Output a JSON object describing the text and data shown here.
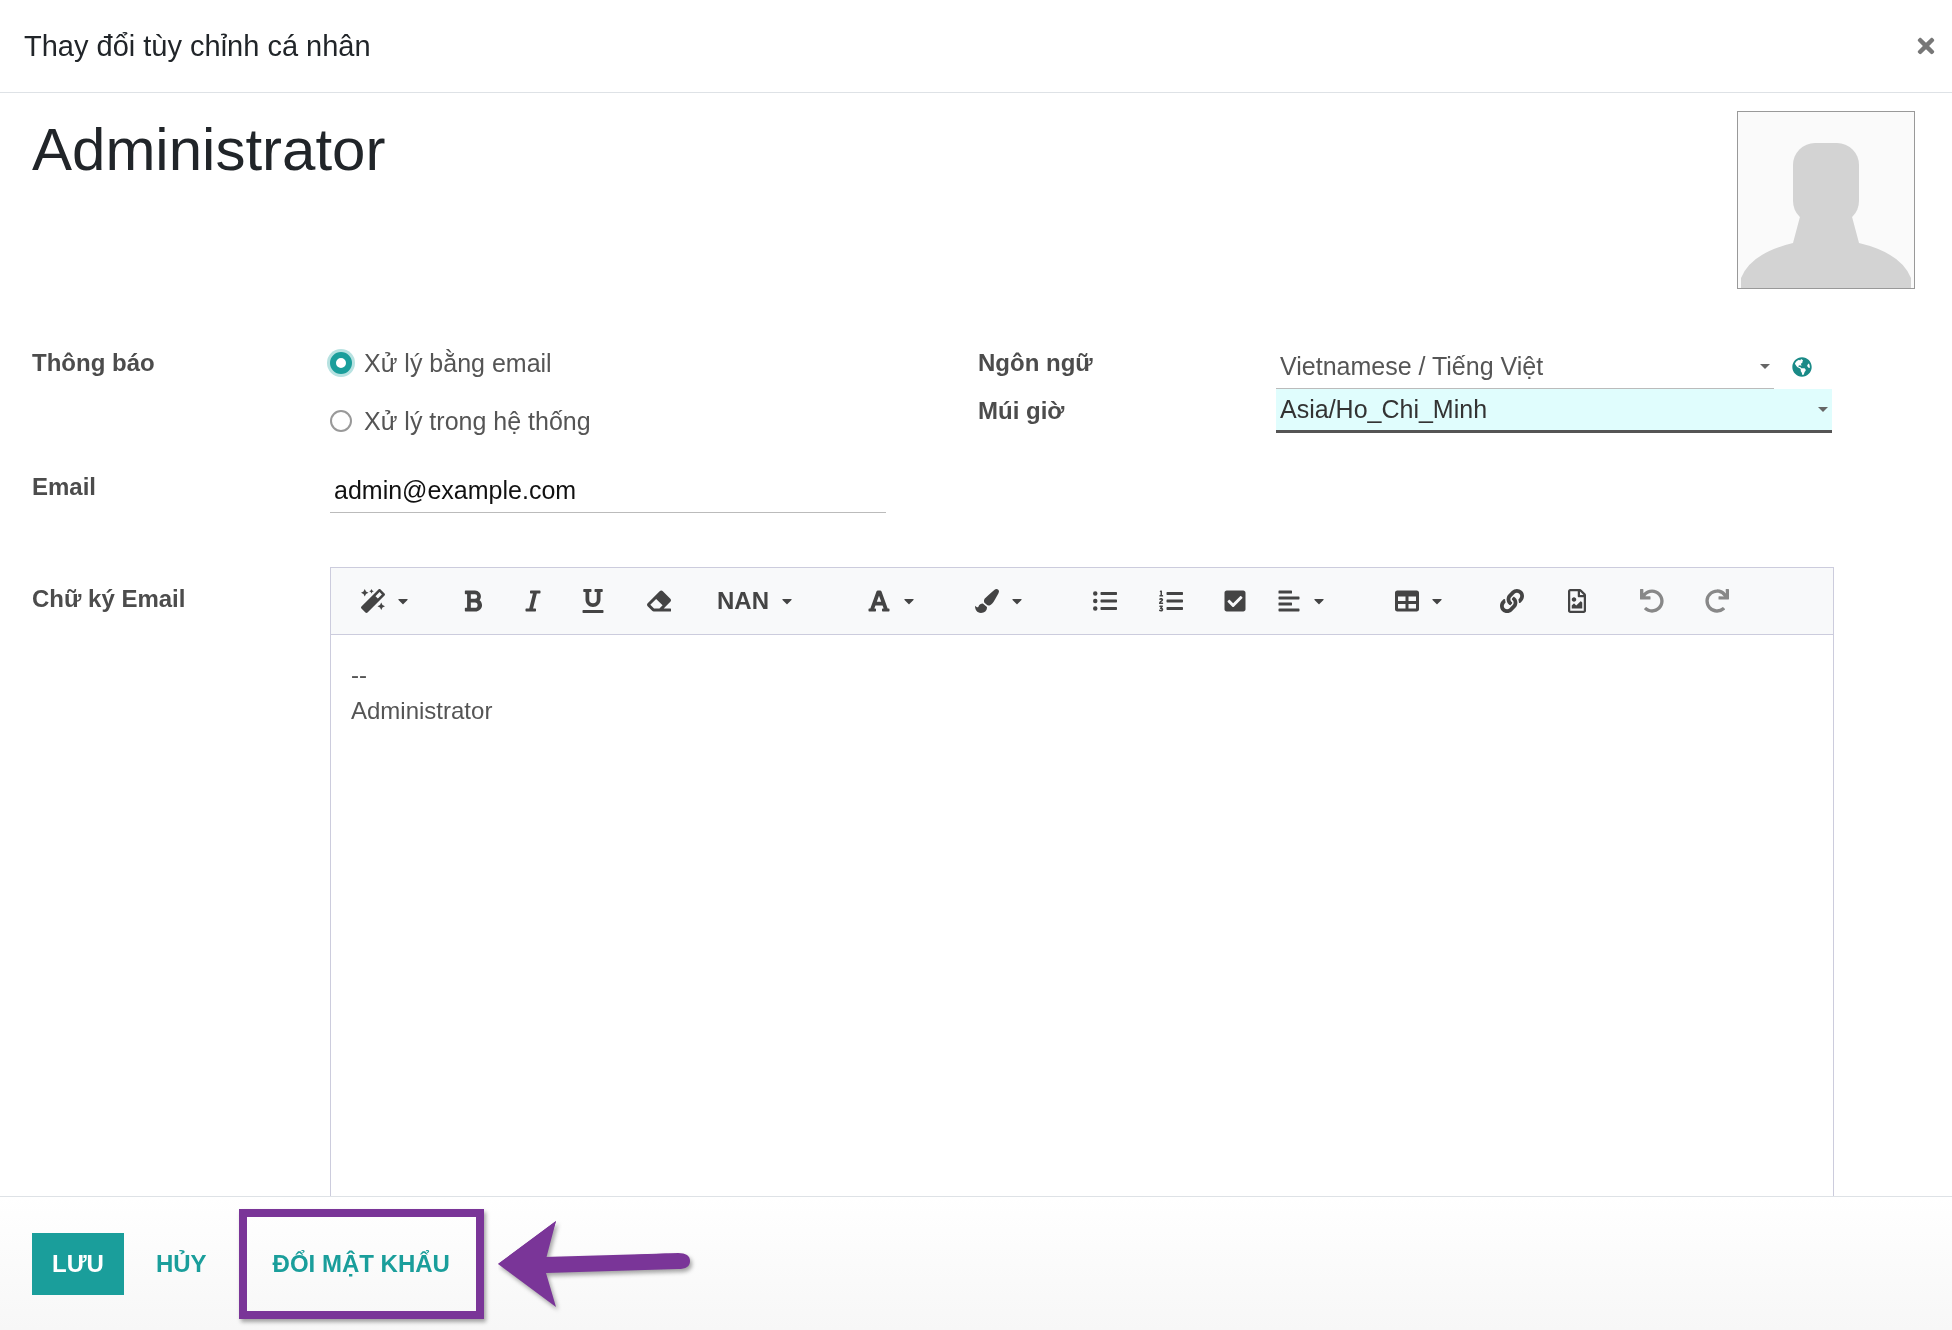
{
  "dialog": {
    "title": "Thay đổi tùy chỉnh cá nhân"
  },
  "name": "Administrator",
  "notification": {
    "label": "Thông báo",
    "options": [
      {
        "label": "Xử lý bằng email",
        "selected": true
      },
      {
        "label": "Xử lý trong hệ thống",
        "selected": false
      }
    ]
  },
  "email": {
    "label": "Email",
    "value": "admin@example.com"
  },
  "language": {
    "label": "Ngôn ngữ",
    "value": "Vietnamese / Tiếng Việt"
  },
  "timezone": {
    "label": "Múi giờ",
    "value": "Asia/Ho_Chi_Minh",
    "focused": true
  },
  "signature": {
    "label": "Chữ ký Email",
    "font_size": "NAN",
    "lines": [
      "--",
      "Administrator"
    ]
  },
  "footer": {
    "buttons": [
      {
        "label": "LƯU",
        "kind": "primary",
        "highlighted": false
      },
      {
        "label": "HỦY",
        "kind": "link",
        "highlighted": false
      },
      {
        "label": "ĐỔI MẬT KHẨU",
        "kind": "link",
        "highlighted": true
      }
    ]
  }
}
